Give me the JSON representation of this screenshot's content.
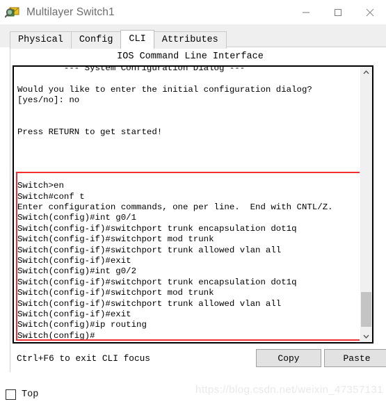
{
  "window": {
    "title": "Multilayer Switch1",
    "icon": "packet-tracer-inspect-icon",
    "controls": {
      "minimize": "minimize-icon",
      "maximize": "maximize-icon",
      "close": "close-icon"
    }
  },
  "tabs": [
    {
      "label": "Physical",
      "active": false
    },
    {
      "label": "Config",
      "active": false
    },
    {
      "label": "CLI",
      "active": true
    },
    {
      "label": "Attributes",
      "active": false
    }
  ],
  "cli": {
    "header": "IOS Command Line Interface",
    "lines": [
      "         --- System Configuration Dialog ---",
      "",
      "Would you like to enter the initial configuration dialog?",
      "[yes/no]: no",
      "",
      "",
      "Press RETURN to get started!",
      "",
      "",
      "",
      "",
      "Switch>en",
      "Switch#conf t",
      "Enter configuration commands, one per line.  End with CNTL/Z.",
      "Switch(config)#int g0/1",
      "Switch(config-if)#switchport trunk encapsulation dot1q",
      "Switch(config-if)#switchport mod trunk",
      "Switch(config-if)#switchport trunk allowed vlan all",
      "Switch(config-if)#exit",
      "Switch(config)#int g0/2",
      "Switch(config-if)#switchport trunk encapsulation dot1q",
      "Switch(config-if)#switchport mod trunk",
      "Switch(config-if)#switchport trunk allowed vlan all",
      "Switch(config-if)#exit",
      "Switch(config)#ip routing",
      "Switch(config)#"
    ],
    "annotation_color": "#f03030",
    "scrollbar": {
      "up_arrow": "chevron-up-icon",
      "down_arrow": "chevron-down-icon"
    }
  },
  "bottom": {
    "hint": "Ctrl+F6 to exit CLI focus",
    "copy_label": "Copy",
    "paste_label": "Paste"
  },
  "footer": {
    "top_checkbox_label": "Top",
    "top_checkbox_checked": false
  },
  "watermark": "https://blog.csdn.net/weixin_47357131"
}
